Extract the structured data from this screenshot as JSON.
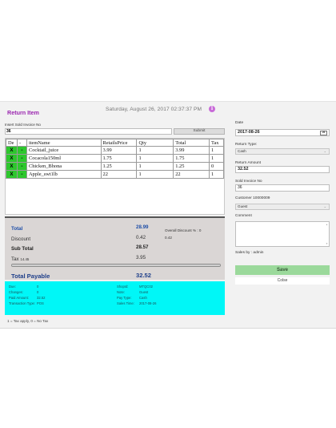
{
  "header": {
    "title": "Return Item",
    "datetime": "Saturday,  August 26,  2017  02:37:37  PM",
    "info_glyph": "i"
  },
  "invoice": {
    "label": "Insert Sold Invoice No",
    "value": "36",
    "submit_label": "Submit"
  },
  "grid": {
    "columns": [
      "De",
      "-",
      "itemName",
      "RetailsPrice",
      "Qty",
      "Total",
      "Tax"
    ],
    "delete_glyph": "X",
    "select_glyph": "-",
    "rows": [
      {
        "item": "Cocktail_juice",
        "price": "3.99",
        "qty": "1",
        "total": "3.99",
        "tax": "1"
      },
      {
        "item": "Cocacola150ml",
        "price": "1.75",
        "qty": "1",
        "total": "1.75",
        "tax": "1"
      },
      {
        "item": "Chicken_Bhona",
        "price": "1.25",
        "qty": "1",
        "total": "1.25",
        "tax": "0"
      },
      {
        "item": "Apple_swt1lb",
        "price": "22",
        "qty": "1",
        "total": "22",
        "tax": "1"
      }
    ]
  },
  "summary": {
    "total_label": "Total",
    "total_value": "28.99",
    "discount_label": "Discount",
    "discount_value": "0.42",
    "overall_discount_label": "Overall Discount % :  0",
    "overall_discount_value": "0.42",
    "subtotal_label": "Sub Total",
    "subtotal_value": "28.57",
    "tax_label": "Tax",
    "tax_rate": "14.45",
    "tax_value": "3.95",
    "progress_fraction": 1.0,
    "payable_label": "Total Payable",
    "payable_value": "32.52"
  },
  "payment": {
    "due_label": "Due:",
    "due_value": "0",
    "changes_label": "Changes:",
    "changes_value": "0",
    "paid_label": "Paid Amount:",
    "paid_value": "32.52",
    "trans_label": "Transaction Type:",
    "trans_value": "POS",
    "shop_label": "ShopId:",
    "shop_value": "MTQC02",
    "note_label": "Note:",
    "note_value": "Guest",
    "paytype_label": "Pay Type:",
    "paytype_value": "Cash",
    "sales_label": "Sales Time:",
    "sales_value": "2017-08-26"
  },
  "legend": "1 = Tax apply, 0 = No Tax",
  "side": {
    "date_label": "Date",
    "date_value": "2017-08-26",
    "calendar_glyph": "26",
    "return_type_label": "Return Type:",
    "return_type_value": "Cash",
    "return_amount_label": "Return Amount",
    "return_amount_value": "32.52",
    "sold_invoice_label": "Sold Invoice No",
    "sold_invoice_value": "36",
    "customer_label": "Customer   10000009",
    "customer_value": "Guest",
    "comment_label": "Comment",
    "sales_by": "Sales by : admin",
    "save_label": "Save",
    "close_label": "Colse"
  },
  "colors": {
    "accent_purple": "#9b27b0",
    "row_green": "#2dc72d",
    "summary_blue": "#1f4fa8",
    "payment_cyan": "#00f7f7",
    "save_green": "#9bd99b"
  },
  "icons": [
    "info-icon",
    "calendar-icon",
    "chevron-down-icon",
    "delete-icon"
  ]
}
